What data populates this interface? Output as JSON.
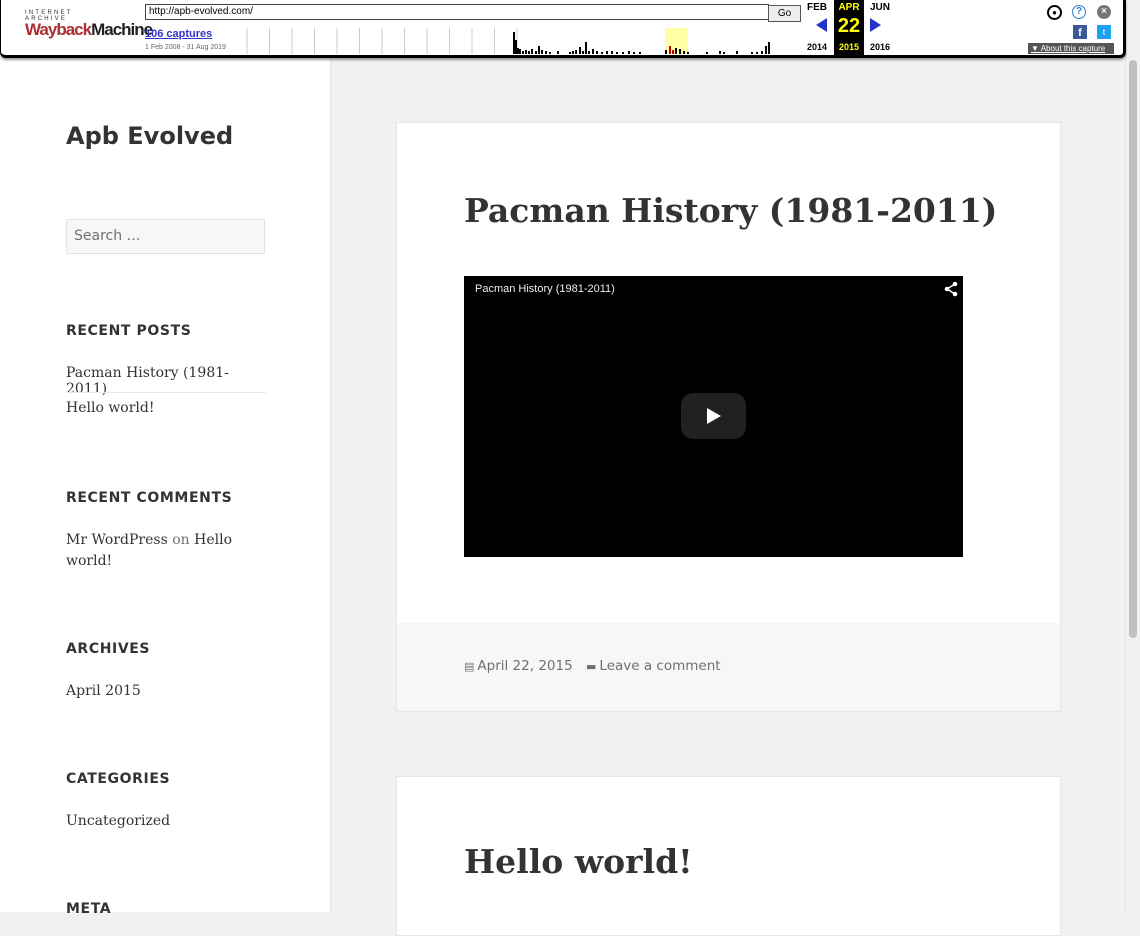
{
  "wayback": {
    "logo_top": "INTERNET ARCHIVE",
    "logo_way": "Wayback",
    "logo_machine": "Machine",
    "url": "http://apb-evolved.com/",
    "go_label": "Go",
    "captures": "106 captures",
    "range": "1 Feb 2008 - 31 Aug 2019",
    "prev_month": "FEB",
    "cur_month": "APR",
    "next_month": "JUN",
    "cur_day": "22",
    "prev_year": "2014",
    "cur_year": "2015",
    "next_year": "2016",
    "about": "About this capture",
    "fb": "f",
    "tw": "t",
    "help": "?",
    "close": "×"
  },
  "sidebar": {
    "site_title": "Apb Evolved",
    "search_placeholder": "Search …",
    "recent_posts_title": "RECENT POSTS",
    "recent_posts": [
      "Pacman History (1981-2011)",
      "Hello world!"
    ],
    "recent_comments_title": "RECENT COMMENTS",
    "comment_author": "Mr WordPress",
    "comment_on": "on",
    "comment_post": "Hello world!",
    "archives_title": "ARCHIVES",
    "archive_item": "April 2015",
    "categories_title": "CATEGORIES",
    "category_item": "Uncategorized",
    "meta_title": "META"
  },
  "posts": [
    {
      "title": "Pacman History (1981-2011)",
      "video_title": "Pacman History (1981-2011)",
      "date": "April 22, 2015",
      "comment_link": "Leave a comment"
    },
    {
      "title": "Hello world!"
    }
  ],
  "icons": {
    "date": "calendar-icon",
    "comment": "comment-icon",
    "share": "share-icon",
    "play": "play-icon"
  }
}
